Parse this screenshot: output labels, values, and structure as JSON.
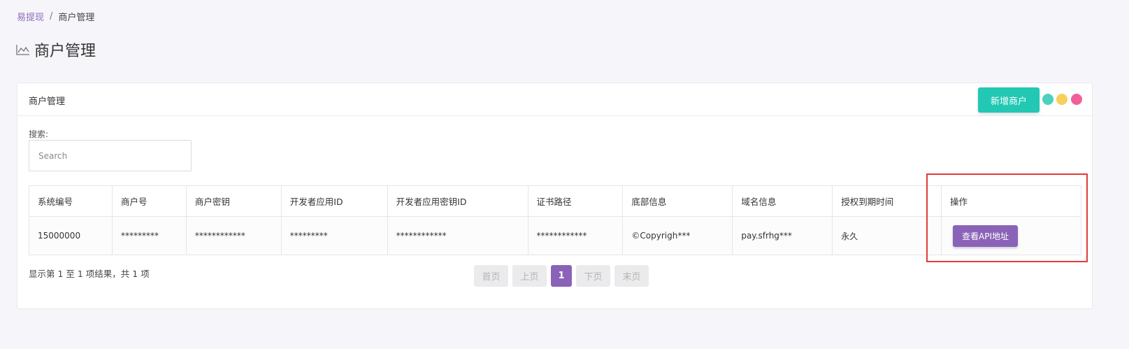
{
  "breadcrumb": {
    "root": "易提现",
    "separator": "/",
    "current": "商户管理"
  },
  "page": {
    "title": "商户管理",
    "title_icon": "area-chart-icon"
  },
  "card": {
    "title": "商户管理",
    "add_button": "新增商户",
    "dots": [
      "#4dd0c0",
      "#f8cf5a",
      "#f2609a"
    ]
  },
  "search": {
    "label": "搜索:",
    "placeholder": "Search",
    "value": ""
  },
  "table": {
    "headers": [
      "系统编号",
      "商户号",
      "商户密钥",
      "开发者应用ID",
      "开发者应用密钥ID",
      "证书路径",
      "底部信息",
      "域名信息",
      "授权到期时间",
      "操作"
    ],
    "rows": [
      {
        "cells": [
          "15000000",
          "*********",
          "************",
          "*********",
          "************",
          "************",
          "©Copyrigh***",
          "pay.sfrhg***",
          "永久"
        ],
        "action": "查看API地址"
      }
    ]
  },
  "footer": {
    "summary": "显示第 1 至 1 项结果，共 1 项",
    "pager": {
      "first": "首页",
      "prev": "上页",
      "current": "1",
      "next": "下页",
      "last": "末页"
    }
  },
  "colors": {
    "accent_purple": "#8a63b8",
    "accent_teal": "#22c8b3",
    "highlight_red": "#e23a3a"
  }
}
